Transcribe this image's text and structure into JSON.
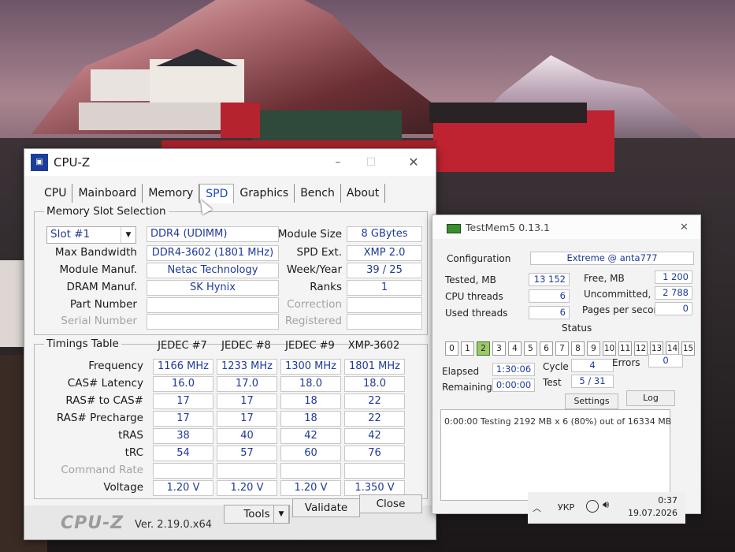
{
  "cpuz": {
    "title": "CPU-Z",
    "tabs": [
      "CPU",
      "Mainboard",
      "Memory",
      "SPD",
      "Graphics",
      "Bench",
      "About"
    ],
    "active_tab": "SPD",
    "slot_section": {
      "legend": "Memory Slot Selection",
      "slot_value": "Slot #1",
      "module_type": "DDR4 (UDIMM)",
      "labels": {
        "max_bandwidth": "Max Bandwidth",
        "module_manuf": "Module Manuf.",
        "dram_manuf": "DRAM Manuf.",
        "part_number": "Part Number",
        "serial_number": "Serial Number",
        "module_size": "Module Size",
        "spd_ext": "SPD Ext.",
        "week_year": "Week/Year",
        "ranks": "Ranks",
        "correction": "Correction",
        "registered": "Registered"
      },
      "values": {
        "max_bandwidth": "DDR4-3602 (1801 MHz)",
        "module_manuf": "Netac Technology",
        "dram_manuf": "SK Hynix",
        "module_size": "8 GBytes",
        "spd_ext": "XMP 2.0",
        "week_year": "39 / 25",
        "ranks": "1"
      }
    },
    "timings": {
      "legend": "Timings Table",
      "columns": [
        "JEDEC #7",
        "JEDEC #8",
        "JEDEC #9",
        "XMP-3602"
      ],
      "rows": [
        {
          "label": "Frequency",
          "values": [
            "1166 MHz",
            "1233 MHz",
            "1300 MHz",
            "1801 MHz"
          ]
        },
        {
          "label": "CAS# Latency",
          "values": [
            "16.0",
            "17.0",
            "18.0",
            "18.0"
          ]
        },
        {
          "label": "RAS# to CAS#",
          "values": [
            "17",
            "17",
            "18",
            "22"
          ]
        },
        {
          "label": "RAS# Precharge",
          "values": [
            "17",
            "17",
            "18",
            "22"
          ]
        },
        {
          "label": "tRAS",
          "values": [
            "38",
            "40",
            "42",
            "42"
          ]
        },
        {
          "label": "tRC",
          "values": [
            "54",
            "57",
            "60",
            "76"
          ]
        },
        {
          "label": "Command Rate",
          "values": [
            "",
            "",
            "",
            ""
          ]
        },
        {
          "label": "Voltage",
          "values": [
            "1.20 V",
            "1.20 V",
            "1.20 V",
            "1.350 V"
          ]
        }
      ]
    },
    "footer": {
      "logo": "CPU-Z",
      "version": "Ver. 2.19.0.x64",
      "tools_label": "Tools",
      "validate_label": "Validate",
      "close_label": "Close"
    }
  },
  "testmem5": {
    "title": "TestMem5  0.13.1",
    "configuration_label": "Configuration",
    "configuration_value": "Extreme @ anta777",
    "tested_label": "Tested, MB",
    "tested_value": "13 152",
    "cpu_threads_label": "CPU threads",
    "cpu_threads_value": "6",
    "used_threads_label": "Used threads",
    "used_threads_value": "6",
    "free_label": "Free, MB",
    "free_value": "1 200",
    "uncommitted_label": "Uncommitted, MB",
    "uncommitted_value": "2 788",
    "pages_label": "Pages per second",
    "pages_value": "0",
    "status_label": "Status",
    "threads": [
      "0",
      "1",
      "2",
      "3",
      "4",
      "5",
      "6",
      "7",
      "8",
      "9",
      "10",
      "11",
      "12",
      "13",
      "14",
      "15"
    ],
    "active_thread": "2",
    "elapsed_label": "Elapsed",
    "elapsed_value": "1:30:06",
    "remaining_label": "Remaining",
    "remaining_value": "0:00:00",
    "cycle_label": "Cycle",
    "cycle_value": "4",
    "test_label": "Test",
    "test_value": "5 / 31",
    "errors_label": "Errors",
    "errors_value": "0",
    "settings_label": "Settings",
    "log_label": "Log",
    "log_text": "0:00:00  Testing 2192 MB x 6 (80%) out of 16334 MB"
  },
  "taskbar": {
    "language": "УКР",
    "time": "0:37",
    "date": "19.07.2026"
  }
}
